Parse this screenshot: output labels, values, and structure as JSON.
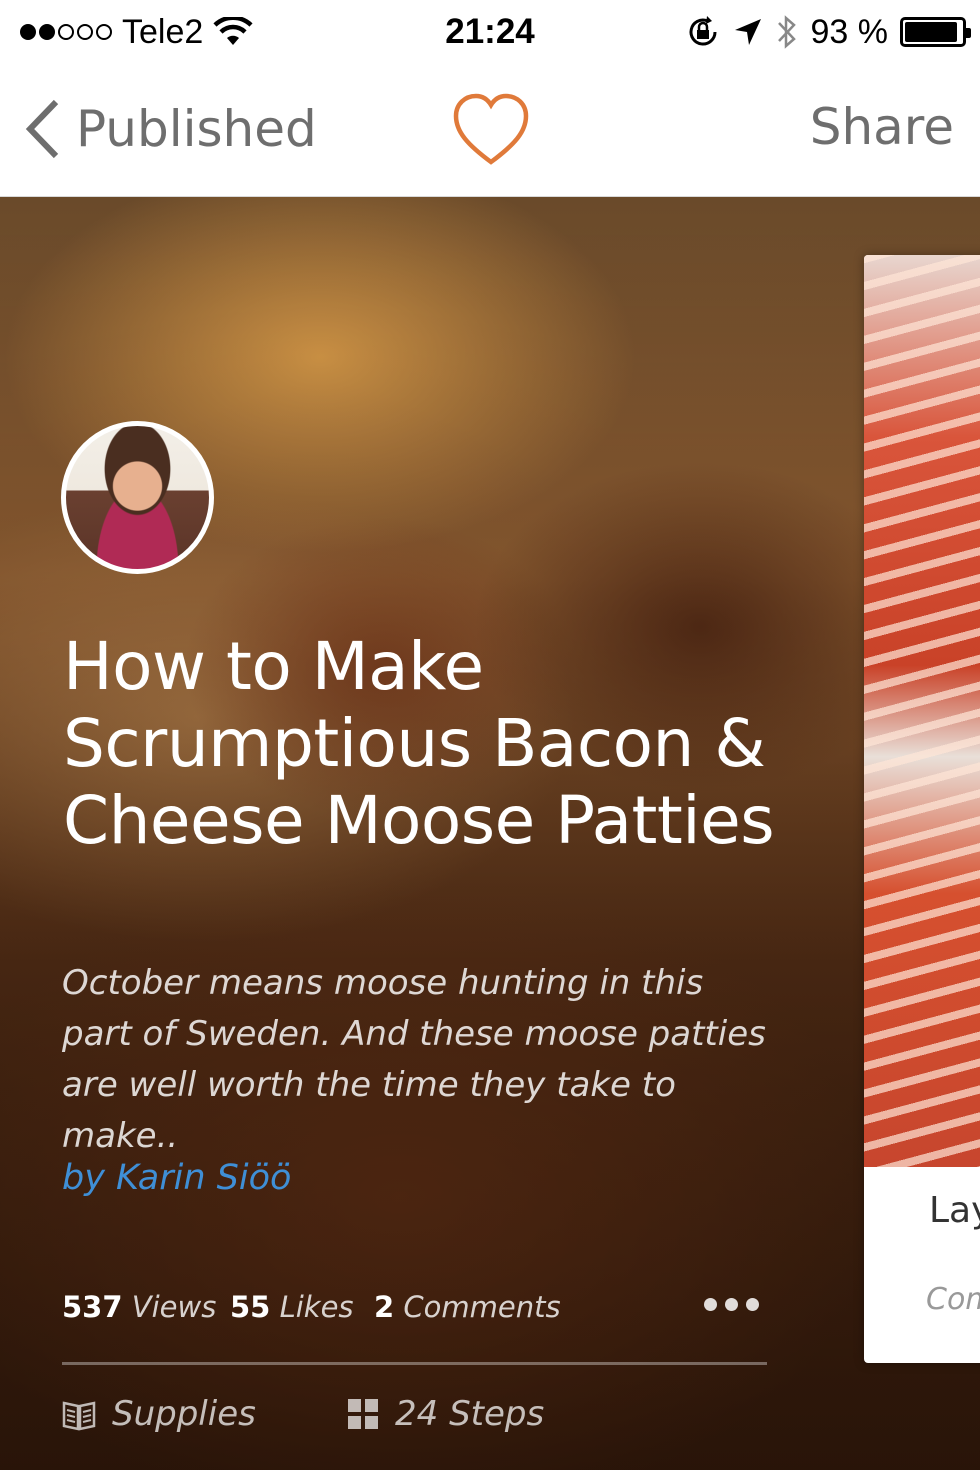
{
  "status_bar": {
    "carrier": "Tele2",
    "time": "21:24",
    "battery_percent": "93 %",
    "battery_level": 0.93,
    "signal_bars_filled": 2,
    "signal_bars_total": 5
  },
  "nav": {
    "back_label": "Published",
    "share_label": "Share",
    "heart_color": "#e07a3a"
  },
  "instructable": {
    "title": "How to Make Scrumptious Bacon & Cheese Moose Patties",
    "description": "October means moose hunting in this part of Sweden. And these moose patties are well worth the time they take to make..",
    "author": "by Karin Siöö",
    "stats": {
      "views_count": "537",
      "views_label": "Views",
      "likes_count": "55",
      "likes_label": "Likes",
      "comments_count": "2",
      "comments_label": "Comments"
    },
    "tabs": {
      "supplies_label": "Supplies",
      "steps_label": "24 Steps"
    }
  },
  "next_card": {
    "title_fragment": "Lay",
    "subtitle_fragment": "Com"
  },
  "colors": {
    "author_link": "#3f8fd6",
    "nav_text": "#6e6e6e"
  }
}
